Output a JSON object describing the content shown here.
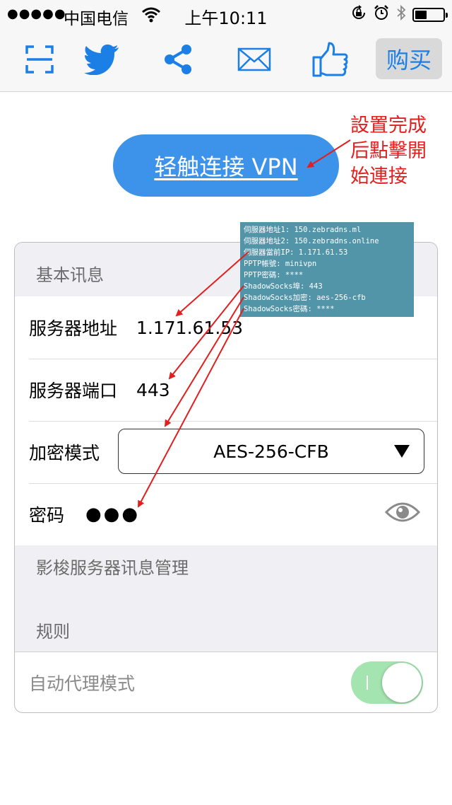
{
  "status_bar": {
    "signal": "●●●●●",
    "carrier": "中国电信",
    "time": "上午10:11"
  },
  "toolbar": {
    "icons": [
      "scan-icon",
      "twitter-icon",
      "share-icon",
      "mail-icon",
      "thumbs-up-icon"
    ],
    "buy_label": "购买",
    "accent": "#1b7fe6"
  },
  "connect": {
    "label": "轻触连接 VPN"
  },
  "note": {
    "lines": [
      "設置完成",
      "后點擊開",
      "始連接"
    ],
    "color": "#e21e1e"
  },
  "info": {
    "lines": [
      "伺服器地址1: 150.zebradns.ml",
      "伺服器地址2: 150.zebradns.online",
      "伺服器當前IP: 1.171.61.53",
      "PPTP帳號: minivpn",
      "PPTP密碼: ****",
      "ShadowSocks埠: 443",
      "ShadowSocks加密: aes-256-cfb",
      "ShadowSocks密碼: ****"
    ]
  },
  "basic": {
    "header": "基本讯息",
    "server_label": "服务器地址",
    "server_value": "1.171.61.53",
    "port_label": "服务器端口",
    "port_value": "443",
    "mode_label": "加密模式",
    "mode_value": "AES-256-CFB",
    "password_label": "密码",
    "password_dots": "●●●"
  },
  "manage": {
    "header": "影梭服务器讯息管理"
  },
  "rules": {
    "header": "规则",
    "auto_proxy_label": "自动代理模式",
    "auto_proxy_on": true
  }
}
